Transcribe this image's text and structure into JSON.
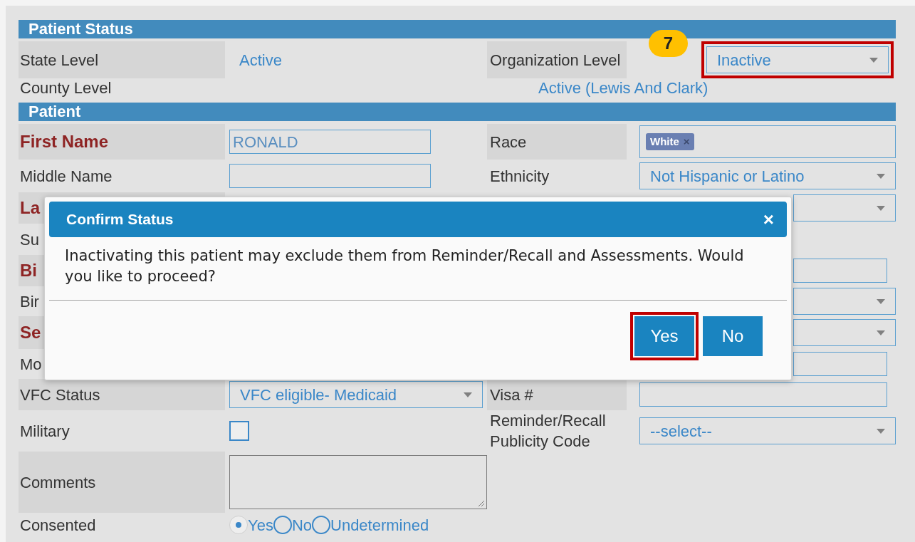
{
  "sections": [
    {
      "title": "Patient Status",
      "rows": [
        {
          "label": "State Level",
          "left": {
            "kind": "text",
            "text": "Active"
          },
          "right_label": "Organization Level",
          "right": {
            "kind": "select",
            "value": "Inactive",
            "highlighted": true
          }
        },
        {
          "label": "County Level",
          "right": {
            "kind": "wide_text",
            "text": "Active (Lewis And Clark)"
          }
        }
      ]
    },
    {
      "title": "Patient",
      "rows": [
        {
          "label": "First Name",
          "required": true,
          "left": {
            "kind": "input",
            "value": "RONALD"
          },
          "right_label": "Race",
          "right": {
            "kind": "chips",
            "chips": [
              "White"
            ],
            "remove": "×"
          }
        },
        {
          "label": "Middle Name",
          "required": false,
          "left": {
            "kind": "input"
          },
          "right_label": "Ethnicity",
          "right": {
            "kind": "select",
            "value": "Not Hispanic or Latino"
          }
        },
        {
          "label": "La",
          "required": true,
          "right": {
            "kind": "select"
          }
        },
        {
          "label": "Su",
          "required": false
        },
        {
          "label": "Bi",
          "required": true,
          "right": {
            "kind": "input"
          }
        },
        {
          "label": "Bir",
          "required": false,
          "right": {
            "kind": "select"
          }
        },
        {
          "label": "Se",
          "required": true,
          "right": {
            "kind": "select"
          }
        },
        {
          "label": "Mo",
          "required": false,
          "right": {
            "kind": "input"
          }
        },
        {
          "label": "VFC Status",
          "required": false,
          "left": {
            "kind": "select",
            "value": "VFC eligible- Medicaid"
          },
          "right_label": "Visa #",
          "right": {
            "kind": "input"
          }
        },
        {
          "label": "Military",
          "required": false,
          "left": {
            "kind": "checkbox",
            "checked": false
          },
          "right_label": "Reminder/Recall Publicity Code",
          "right": {
            "kind": "select",
            "value": "--select--"
          }
        },
        {
          "label": "Comments",
          "required": false,
          "left": {
            "kind": "textarea"
          }
        },
        {
          "label": "Consented",
          "required": false,
          "left": {
            "kind": "radios",
            "options": [
              {
                "label": "Yes",
                "selected": true
              },
              {
                "label": "No",
                "selected": false
              },
              {
                "label": "Undetermined",
                "selected": false
              }
            ]
          }
        }
      ]
    }
  ],
  "step_badge": "7",
  "dialog": {
    "title": "Confirm Status",
    "close": "×",
    "message": "Inactivating this patient may exclude them from Reminder/Recall and Assessments. Would you like to proceed?",
    "buttons": [
      {
        "label": "Yes",
        "highlighted": true
      },
      {
        "label": "No",
        "highlighted": false
      }
    ]
  }
}
